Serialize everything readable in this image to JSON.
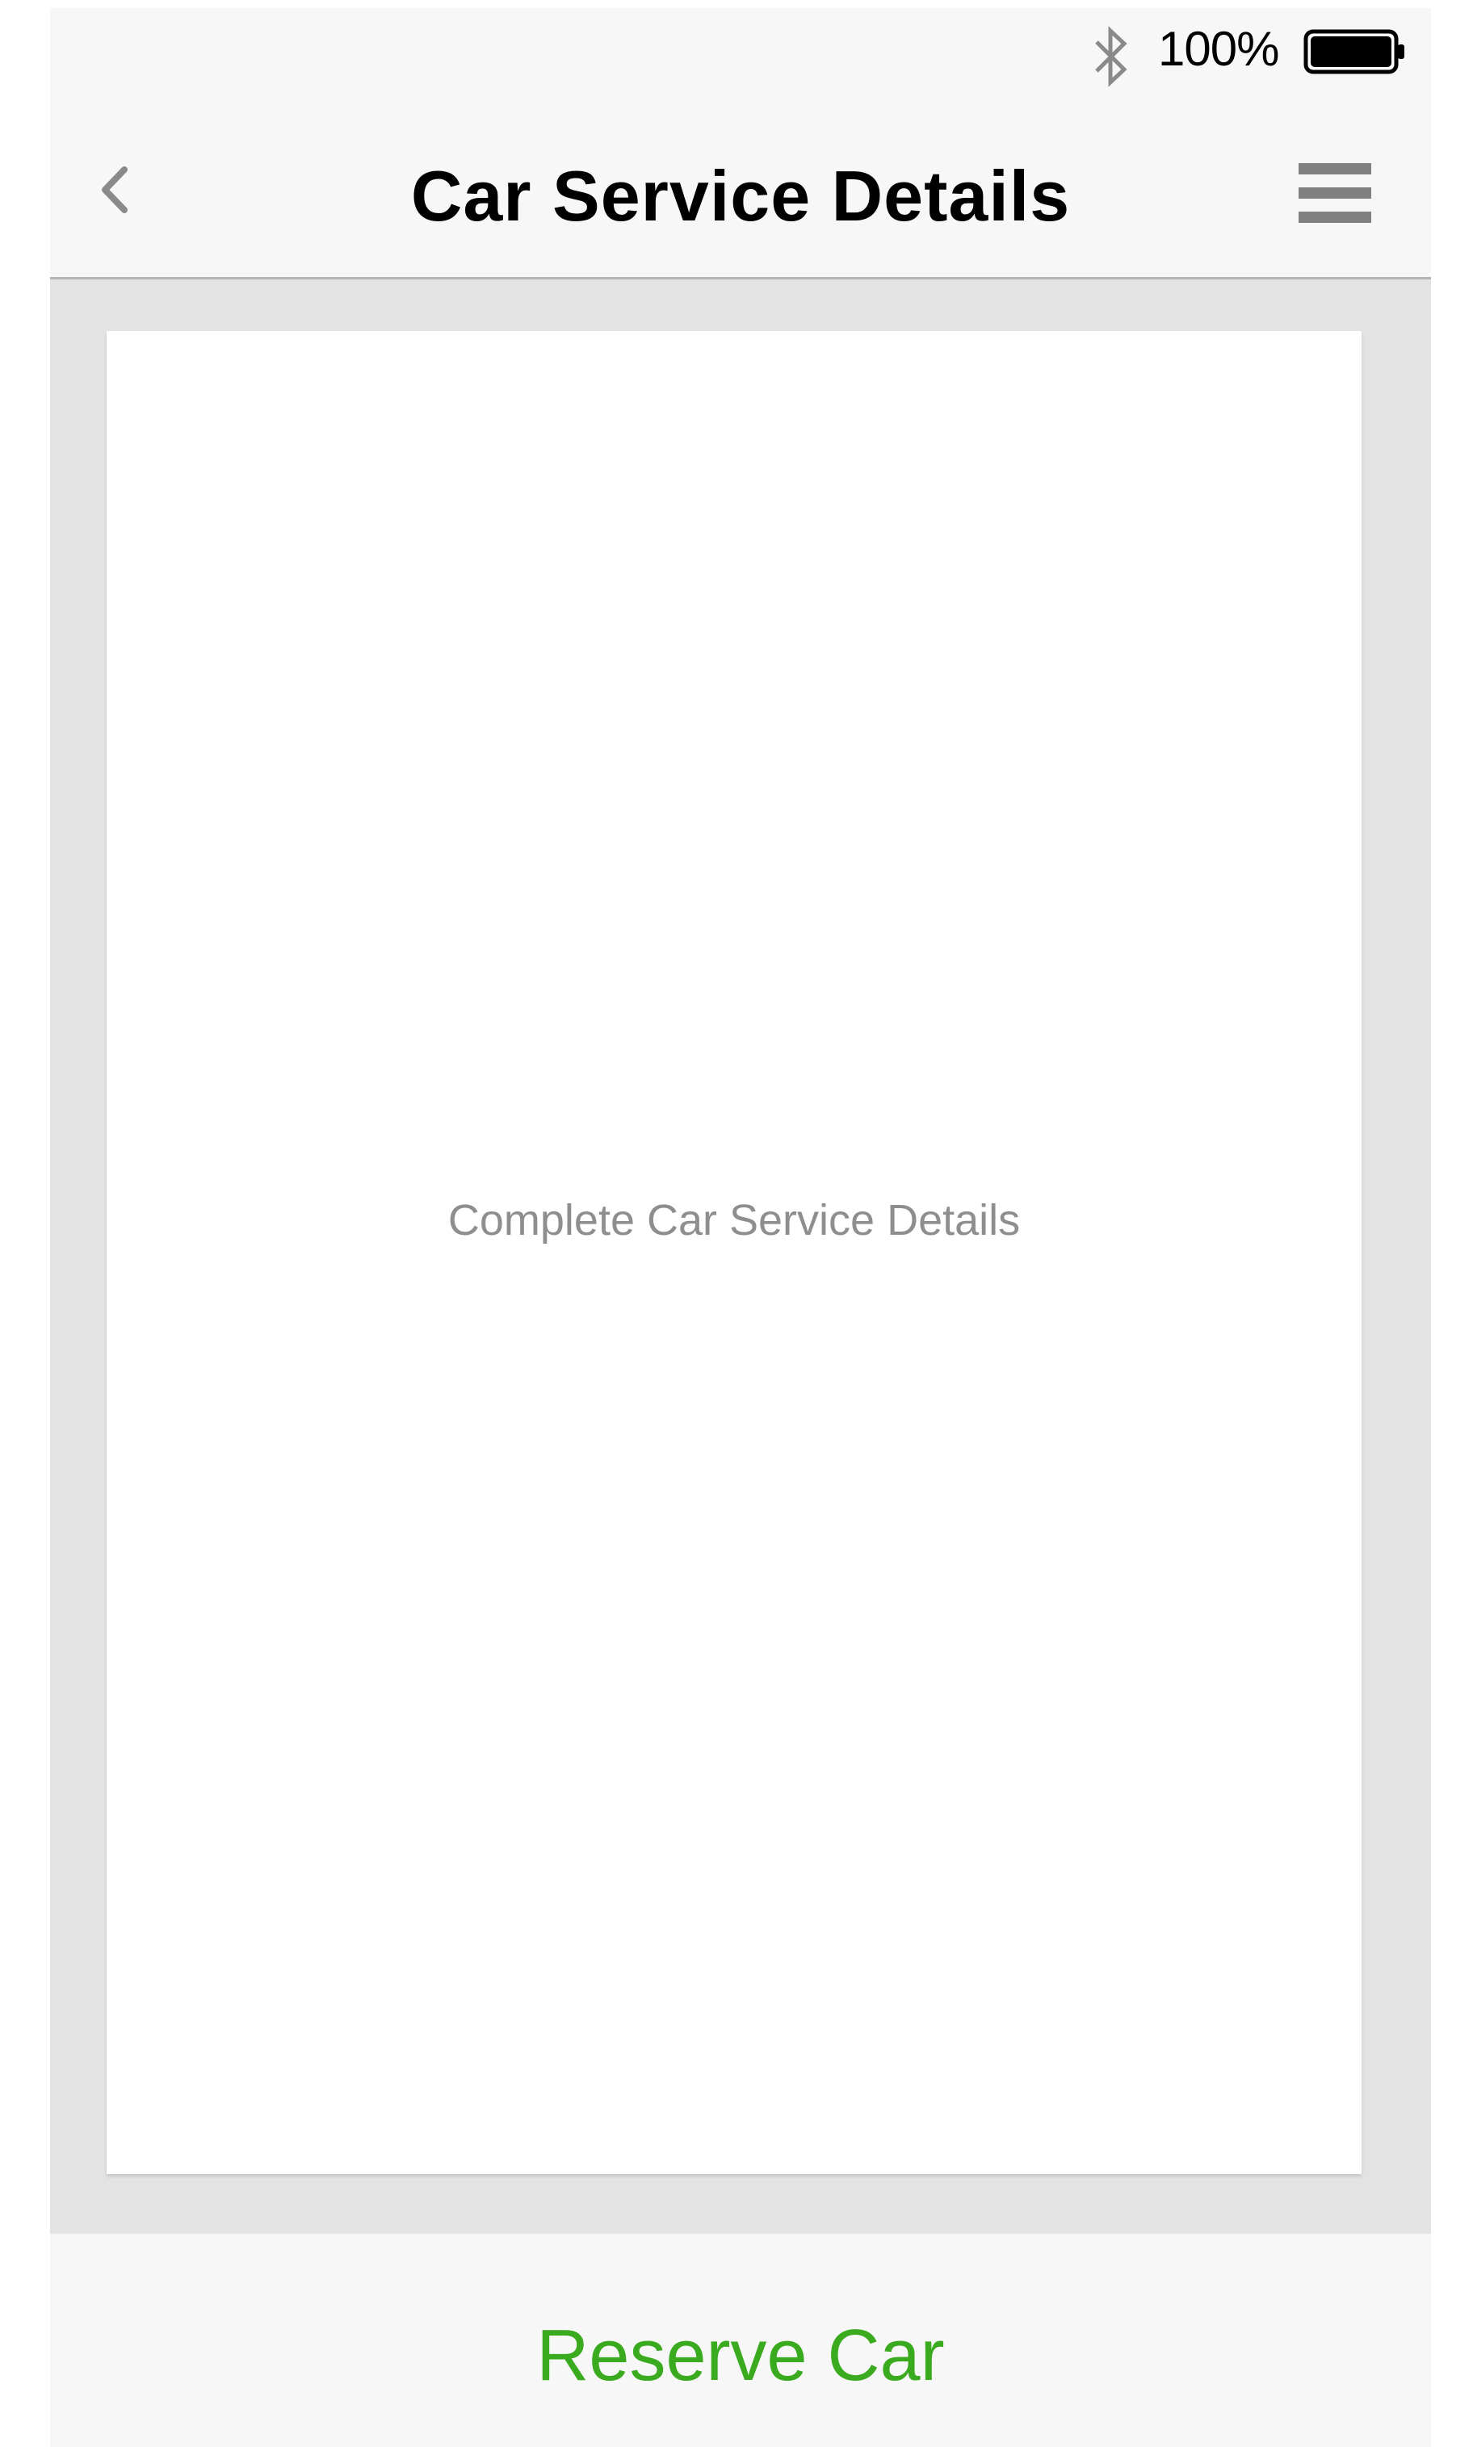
{
  "status_bar": {
    "bluetooth_icon": "bluetooth-icon",
    "battery_percent": "100%",
    "battery_icon": "battery-full-icon"
  },
  "nav_bar": {
    "back_icon": "chevron-left-icon",
    "title": "Car Service Details",
    "menu_icon": "hamburger-menu-icon"
  },
  "content": {
    "details_text": "Complete Car Service Details"
  },
  "bottom_bar": {
    "reserve_label": "Reserve Car"
  },
  "colors": {
    "accent_green": "#3aaa1e",
    "bar_background": "#f7f7f7",
    "content_background": "#e3e3e3",
    "secondary_text": "#8e8e8e"
  }
}
